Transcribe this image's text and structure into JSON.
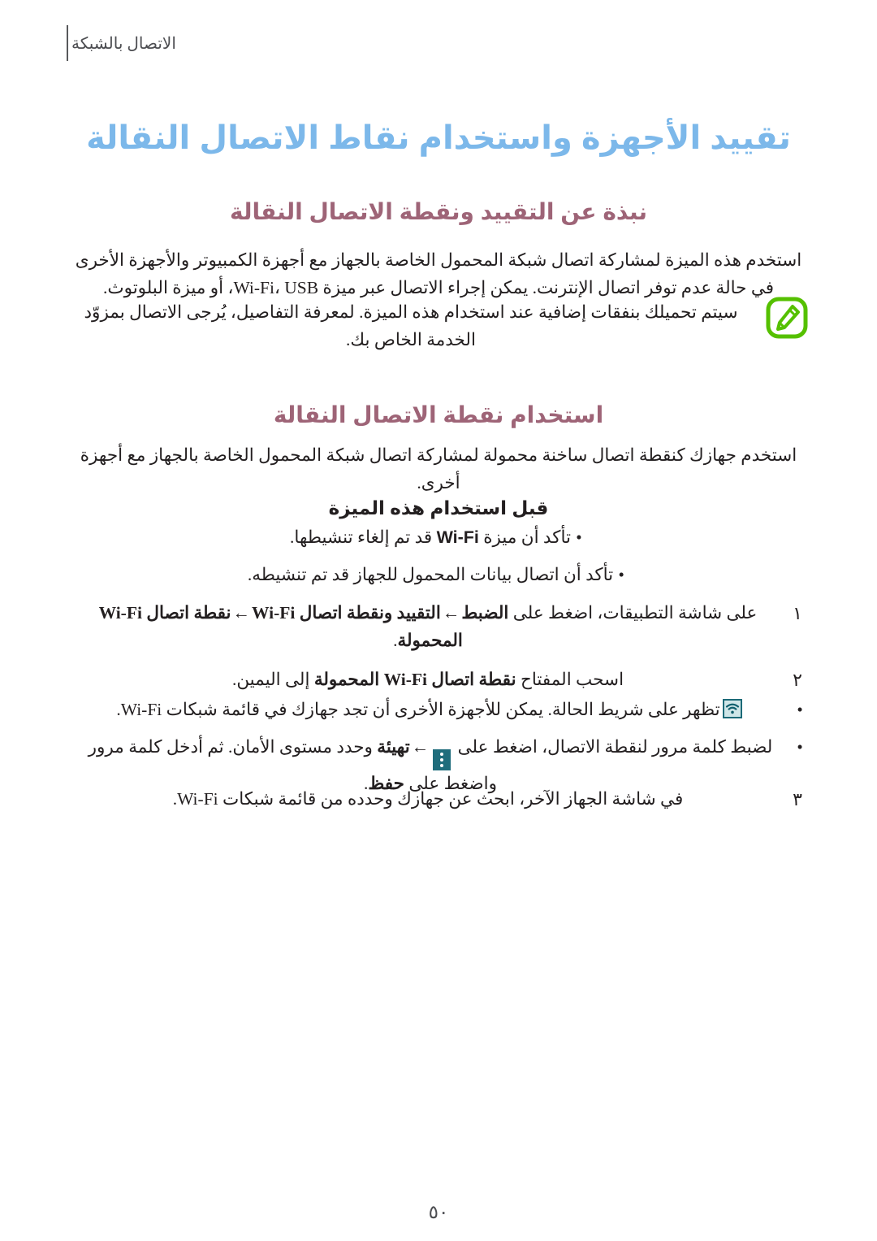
{
  "header": {
    "running_title": "الاتصال بالشبكة"
  },
  "title": {
    "chapter": "تقييد الأجهزة واستخدام نقاط الاتصال النقالة"
  },
  "sections": {
    "about": {
      "heading": "نبذة عن التقييد ونقطة الاتصال النقالة",
      "paragraph": "استخدم هذه الميزة لمشاركة اتصال شبكة المحمول الخاصة بالجهاز مع أجهزة الكمبيوتر والأجهزة الأخرى في حالة عدم توفر اتصال الإنترنت. يمكن إجراء الاتصال عبر ميزة Wi-Fi، USB، أو ميزة البلوتوث."
    },
    "note": {
      "icon": "note-pen-icon",
      "icon_color": "#55c000",
      "text": "سيتم تحميلك بنفقات إضافية عند استخدام هذه الميزة. لمعرفة التفاصيل، يُرجى الاتصال بمزوّد الخدمة الخاص بك."
    },
    "hotspot": {
      "heading": "استخدام نقطة الاتصال النقالة",
      "paragraph": "استخدم جهازك كنقطة اتصال ساخنة محمولة لمشاركة اتصال شبكة المحمول الخاصة بالجهاز مع أجهزة أخرى.",
      "before_use_heading": "قبل استخدام هذه الميزة",
      "before_use_bullets": [
        {
          "pre": "تأكد أن ميزة ",
          "emphasis": "Wi-Fi",
          "post": " قد تم إلغاء تنشيطها."
        },
        {
          "pre": "تأكد أن اتصال بيانات المحمول للجهاز قد تم تنشيطه.",
          "emphasis": "",
          "post": ""
        }
      ],
      "steps": [
        {
          "number": "١",
          "segments": [
            {
              "text": "على شاشة التطبيقات، اضغط على ",
              "style": "normal"
            },
            {
              "text": "الضبط",
              "style": "bold"
            },
            {
              "text": "←",
              "style": "arrow"
            },
            {
              "text": "التقييد ونقطة اتصال Wi-Fi",
              "style": "bold"
            },
            {
              "text": "←",
              "style": "arrow"
            },
            {
              "text": "نقطة اتصال Wi-Fi المحمولة",
              "style": "bold"
            },
            {
              "text": ".",
              "style": "normal"
            }
          ]
        },
        {
          "number": "٢",
          "segments": [
            {
              "text": "اسحب المفتاح ",
              "style": "normal"
            },
            {
              "text": "نقطة اتصال Wi-Fi المحمولة",
              "style": "bold"
            },
            {
              "text": " إلى اليمين.",
              "style": "normal"
            }
          ]
        }
      ],
      "status_bullets": [
        {
          "icon": "wifi-status-icon",
          "text": "تظهر على شريط الحالة. يمكن للأجهزة الأخرى أن تجد جهازك في قائمة شبكات Wi-Fi."
        },
        {
          "icon": "more-options-icon",
          "pre": "لضبط كلمة مرور لنقطة الاتصال، اضغط على ",
          "arrow": "←",
          "emphasis_1": "تهيئة",
          "mid": " وحدد مستوى الأمان. ثم أدخل كلمة مرور ",
          "tail_pre": "واضغط على ",
          "emphasis_2": "حفظ",
          "tail_post": "."
        }
      ],
      "final_step": {
        "number": "٣",
        "text": "في شاشة الجهاز الآخر، ابحث عن جهازك وحدده من قائمة شبكات Wi-Fi."
      }
    }
  },
  "footer": {
    "page_number": "٥٠"
  },
  "colors": {
    "chapter_title": "#7cb8ea",
    "section_heading": "#9e6477",
    "note_icon": "#55c000",
    "status_icon": "#1f6d7c",
    "body_text": "#231f20"
  }
}
